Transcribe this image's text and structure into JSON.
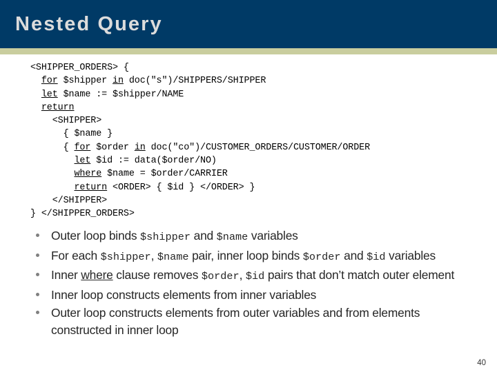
{
  "slide": {
    "title": "Nested Query",
    "page_number": "40",
    "colors": {
      "header_bg": "#003a66",
      "header_stripe": "#c9cd9e",
      "title_text": "#dcdcdc",
      "body_bg": "#ffffff",
      "body_text": "#262626",
      "code_text": "#000000",
      "bullet_dot": "#808080"
    }
  },
  "code": {
    "lines": [
      [
        {
          "t": "<SHIPPER_ORDERS> {",
          "u": false
        }
      ],
      [
        {
          "t": "  ",
          "u": false
        },
        {
          "t": "for",
          "u": true
        },
        {
          "t": " $shipper ",
          "u": false
        },
        {
          "t": "in",
          "u": true
        },
        {
          "t": " doc(\"s\")/SHIPPERS/SHIPPER",
          "u": false
        }
      ],
      [
        {
          "t": "  ",
          "u": false
        },
        {
          "t": "let",
          "u": true
        },
        {
          "t": " $name := $shipper/NAME",
          "u": false
        }
      ],
      [
        {
          "t": "  ",
          "u": false
        },
        {
          "t": "return",
          "u": true
        }
      ],
      [
        {
          "t": "    <SHIPPER>",
          "u": false
        }
      ],
      [
        {
          "t": "      { $name }",
          "u": false
        }
      ],
      [
        {
          "t": "      { ",
          "u": false
        },
        {
          "t": "for",
          "u": true
        },
        {
          "t": " $order ",
          "u": false
        },
        {
          "t": "in",
          "u": true
        },
        {
          "t": " doc(\"co\")/CUSTOMER_ORDERS/CUSTOMER/ORDER",
          "u": false
        }
      ],
      [
        {
          "t": "        ",
          "u": false
        },
        {
          "t": "let",
          "u": true
        },
        {
          "t": " $id := data($order/NO)",
          "u": false
        }
      ],
      [
        {
          "t": "        ",
          "u": false
        },
        {
          "t": "where",
          "u": true
        },
        {
          "t": " $name = $order/CARRIER",
          "u": false
        }
      ],
      [
        {
          "t": "        ",
          "u": false
        },
        {
          "t": "return",
          "u": true
        },
        {
          "t": " <ORDER> { $id } </ORDER> }",
          "u": false
        }
      ],
      [
        {
          "t": "    </SHIPPER>",
          "u": false
        }
      ],
      [
        {
          "t": "} </SHIPPER_ORDERS>",
          "u": false
        }
      ]
    ]
  },
  "bullets": [
    {
      "parts": [
        {
          "t": "Outer loop binds ",
          "k": "text"
        },
        {
          "t": "$shipper",
          "k": "code"
        },
        {
          "t": " and ",
          "k": "text"
        },
        {
          "t": "$name",
          "k": "code"
        },
        {
          "t": " variables",
          "k": "text"
        }
      ]
    },
    {
      "parts": [
        {
          "t": "For each ",
          "k": "text"
        },
        {
          "t": "$shipper",
          "k": "code"
        },
        {
          "t": ", ",
          "k": "text"
        },
        {
          "t": "$name",
          "k": "code"
        },
        {
          "t": " pair, inner loop binds ",
          "k": "text"
        },
        {
          "t": "$order",
          "k": "code"
        },
        {
          "t": " and ",
          "k": "text"
        },
        {
          "t": "$id",
          "k": "code"
        },
        {
          "t": " variables",
          "k": "text"
        }
      ]
    },
    {
      "parts": [
        {
          "t": "Inner ",
          "k": "text"
        },
        {
          "t": "where",
          "k": "underline"
        },
        {
          "t": " clause removes ",
          "k": "text"
        },
        {
          "t": "$order",
          "k": "code"
        },
        {
          "t": ", ",
          "k": "text"
        },
        {
          "t": "$id",
          "k": "code"
        },
        {
          "t": " pairs that don’t match outer element",
          "k": "text"
        }
      ]
    },
    {
      "parts": [
        {
          "t": "Inner loop constructs elements from inner variables",
          "k": "text"
        }
      ]
    },
    {
      "parts": [
        {
          "t": "Outer loop constructs elements from outer variables and from elements constructed in inner loop",
          "k": "text"
        }
      ]
    }
  ]
}
